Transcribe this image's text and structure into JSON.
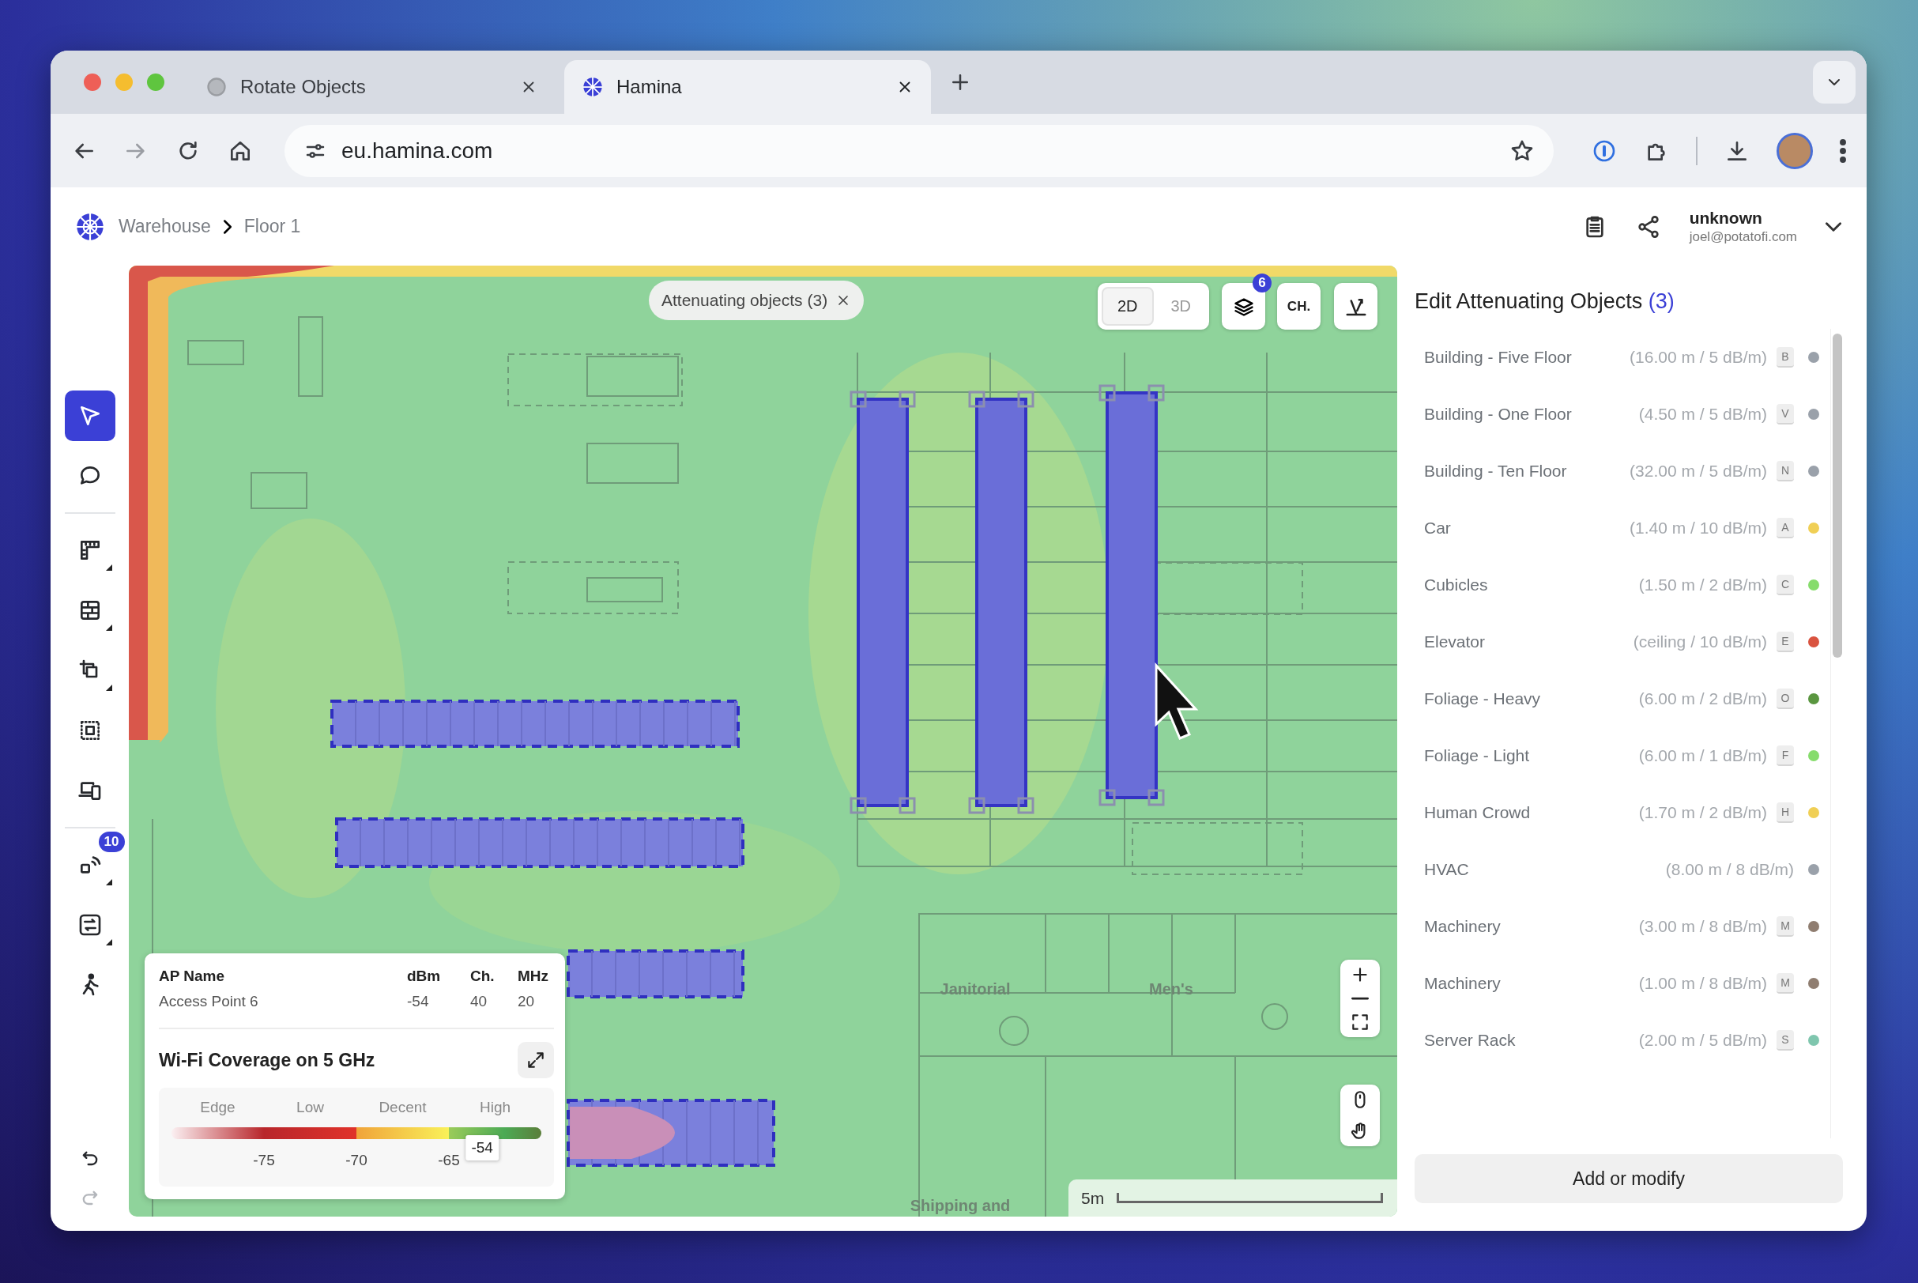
{
  "browser": {
    "tabs": [
      {
        "title": "Rotate Objects",
        "selected": false
      },
      {
        "title": "Hamina",
        "selected": true
      }
    ],
    "url": "eu.hamina.com"
  },
  "header": {
    "breadcrumb": [
      "Warehouse",
      "Floor 1"
    ],
    "user": {
      "name": "unknown",
      "email": "joel@potatofi.com"
    }
  },
  "sidebar": {
    "tool_groups": [
      [
        {
          "kind": "pointer",
          "selected": true,
          "submenu": false
        },
        {
          "kind": "comment",
          "selected": false,
          "submenu": false
        }
      ],
      [
        {
          "kind": "ruler",
          "selected": false,
          "submenu": true
        },
        {
          "kind": "wall",
          "selected": false,
          "submenu": true
        },
        {
          "kind": "transform",
          "selected": false,
          "submenu": true
        },
        {
          "kind": "area",
          "selected": false,
          "submenu": false
        },
        {
          "kind": "devices",
          "selected": false,
          "submenu": false
        }
      ],
      [
        {
          "kind": "access-point",
          "selected": false,
          "submenu": true,
          "badge": "10"
        },
        {
          "kind": "scan",
          "selected": false,
          "submenu": true
        },
        {
          "kind": "walker",
          "selected": false,
          "submenu": false
        }
      ]
    ],
    "history": [
      {
        "kind": "undo",
        "disabled": false
      },
      {
        "kind": "redo",
        "disabled": true
      }
    ]
  },
  "map": {
    "filter_chip": "Attenuating objects (3)",
    "view_modes": [
      {
        "label": "2D",
        "selected": true
      },
      {
        "label": "3D",
        "selected": false
      }
    ],
    "layers_badge": "6",
    "channel_button": "CH.",
    "objects": [
      {
        "selected": false
      },
      {
        "selected": false
      },
      {
        "selected": false
      },
      {
        "selected": false
      },
      {
        "selected": true
      },
      {
        "selected": true
      },
      {
        "selected": true
      }
    ],
    "room_labels": [
      "Janitorial",
      "Men's",
      "Shipping and"
    ],
    "scale_label": "5m",
    "ap_info": {
      "columns": [
        "AP Name",
        "dBm",
        "Ch.",
        "MHz"
      ],
      "row": [
        "Access Point 6",
        "-54",
        "40",
        "20"
      ]
    },
    "coverage": {
      "title": "Wi-Fi Coverage on 5 GHz",
      "bands": [
        "Edge",
        "Low",
        "Decent",
        "High"
      ],
      "ticks": [
        "-75",
        "-70",
        "-65"
      ],
      "marker": "-54",
      "level": 0.84
    }
  },
  "panel": {
    "title": "Edit Attenuating Objects",
    "count": "(3)",
    "objects": [
      {
        "name": "Building - Five Floor",
        "spec": "(16.00 m / 5 dB/m)",
        "key": "B",
        "color": "#9aa1aa"
      },
      {
        "name": "Building - One Floor",
        "spec": "(4.50 m / 5 dB/m)",
        "key": "V",
        "color": "#9aa1aa"
      },
      {
        "name": "Building - Ten Floor",
        "spec": "(32.00 m / 5 dB/m)",
        "key": "N",
        "color": "#9aa1aa"
      },
      {
        "name": "Car",
        "spec": "(1.40 m / 10 dB/m)",
        "key": "A",
        "color": "#f0cf55"
      },
      {
        "name": "Cubicles",
        "spec": "(1.50 m / 2 dB/m)",
        "key": "C",
        "color": "#86dc6c"
      },
      {
        "name": "Elevator",
        "spec": "(ceiling / 10 dB/m)",
        "key": "E",
        "color": "#d9533f"
      },
      {
        "name": "Foliage - Heavy",
        "spec": "(6.00 m / 2 dB/m)",
        "key": "O",
        "color": "#5a9640"
      },
      {
        "name": "Foliage - Light",
        "spec": "(6.00 m / 1 dB/m)",
        "key": "F",
        "color": "#86dc6c"
      },
      {
        "name": "Human Crowd",
        "spec": "(1.70 m / 2 dB/m)",
        "key": "H",
        "color": "#f0cf55"
      },
      {
        "name": "HVAC",
        "spec": "(8.00 m / 8 dB/m)",
        "color": "#9aa1aa"
      },
      {
        "name": "Machinery",
        "spec": "(3.00 m / 8 dB/m)",
        "key": "M",
        "color": "#8f7d70"
      },
      {
        "name": "Machinery",
        "spec": "(1.00 m / 8 dB/m)",
        "key": "M",
        "color": "#8f7d70"
      },
      {
        "name": "Server Rack",
        "spec": "(2.00 m / 5 dB/m)",
        "key": "S",
        "color": "#7fc6ae"
      }
    ],
    "button": "Add or modify"
  }
}
